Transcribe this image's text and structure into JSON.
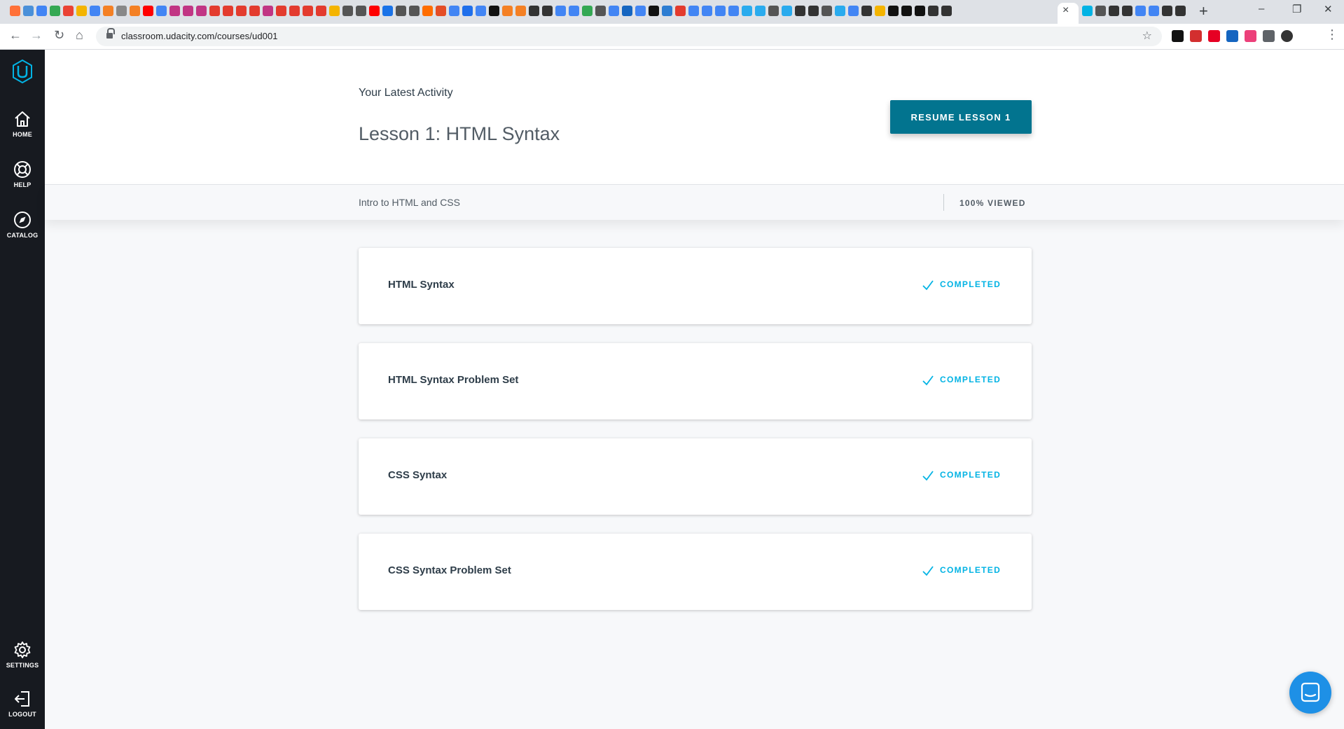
{
  "browser": {
    "url": "classroom.udacity.com/courses/ud001",
    "tab_close": "×",
    "new_tab": "+",
    "window_controls": [
      "–",
      "❐",
      "✕"
    ],
    "favicon_colors_before": [
      "#ff7139",
      "#4a90d9",
      "#4285f4",
      "#34a853",
      "#ea4335",
      "#f4b400",
      "#4285f4",
      "#f48024",
      "#888888",
      "#f48024",
      "#ff0000",
      "#4285f4",
      "#c13584",
      "#c13584",
      "#c13584",
      "#e33b2e",
      "#e33b2e",
      "#e33b2e",
      "#e33b2e",
      "#c13584",
      "#e33b2e",
      "#e33b2e",
      "#e33b2e",
      "#e33b2e",
      "#f4b400",
      "#555555",
      "#555555",
      "#ff0000",
      "#1a73e8",
      "#555555",
      "#555555",
      "#ff6d00",
      "#e44d26",
      "#4285f4",
      "#1f6feb",
      "#4285f4",
      "#111111",
      "#f48024",
      "#f48024",
      "#333333",
      "#333333",
      "#4285f4",
      "#4285f4",
      "#34a853",
      "#555555",
      "#4285f4",
      "#1565c0",
      "#4285f4",
      "#111111",
      "#2d7dd2",
      "#e33b2e",
      "#4285f4",
      "#4285f4",
      "#4285f4",
      "#4285f4",
      "#2aabee",
      "#2aabee",
      "#555555",
      "#2aabee",
      "#333333",
      "#333333",
      "#555555",
      "#2aabee",
      "#4285f4",
      "#333333",
      "#f4b400",
      "#111111",
      "#111111",
      "#111111",
      "#333333",
      "#333333"
    ],
    "favicon_colors_after": [
      "#02b3e4",
      "#555555",
      "#333333",
      "#333333",
      "#4285f4",
      "#4285f4",
      "#333333",
      "#333333"
    ],
    "extension_colors": [
      "#111111",
      "#d32f2f",
      "#e60023",
      "#1565c0",
      "#ec407a",
      "#5f6368",
      "#333333"
    ]
  },
  "sidebar": {
    "logo": "udacity-logo",
    "items": [
      {
        "label": "HOME",
        "icon": "home-icon"
      },
      {
        "label": "HELP",
        "icon": "lifebuoy-icon"
      },
      {
        "label": "CATALOG",
        "icon": "compass-icon"
      },
      {
        "label": "SETTINGS",
        "icon": "gear-icon"
      },
      {
        "label": "LOGOUT",
        "icon": "logout-icon"
      }
    ]
  },
  "header": {
    "activity_label": "Your Latest Activity",
    "lesson_title": "Lesson 1: HTML Syntax",
    "resume_label": "RESUME LESSON 1",
    "course_name": "Intro to HTML and CSS",
    "viewed": "100% VIEWED"
  },
  "concepts": [
    {
      "title": "HTML Syntax",
      "status": "COMPLETED"
    },
    {
      "title": "HTML Syntax Problem Set",
      "status": "COMPLETED"
    },
    {
      "title": "CSS Syntax",
      "status": "COMPLETED"
    },
    {
      "title": "CSS Syntax Problem Set",
      "status": "COMPLETED"
    }
  ],
  "colors": {
    "accent": "#02748f",
    "completed": "#02b3e4",
    "sidebar": "#171a20",
    "chat": "#1e90e6"
  }
}
